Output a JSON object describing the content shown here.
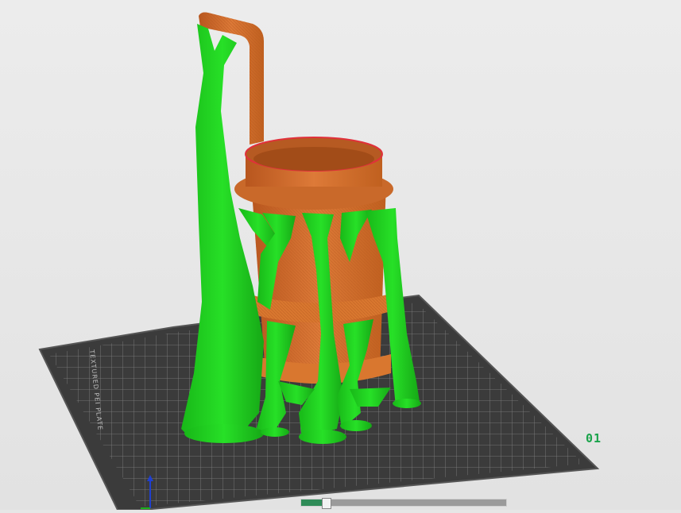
{
  "viewport": {
    "plate_label": "01",
    "plate_brand": "TEXTURED PEI PLATE",
    "layer_progress": 0.12
  },
  "colors": {
    "background": "#e6e6e6",
    "plate": "#3b3b3b",
    "grid": "#8c8c8c",
    "model": "#d06a2a",
    "support": "#1fd01f",
    "accent": "#19a34a"
  },
  "icons": [
    "axis-gizmo-icon"
  ]
}
